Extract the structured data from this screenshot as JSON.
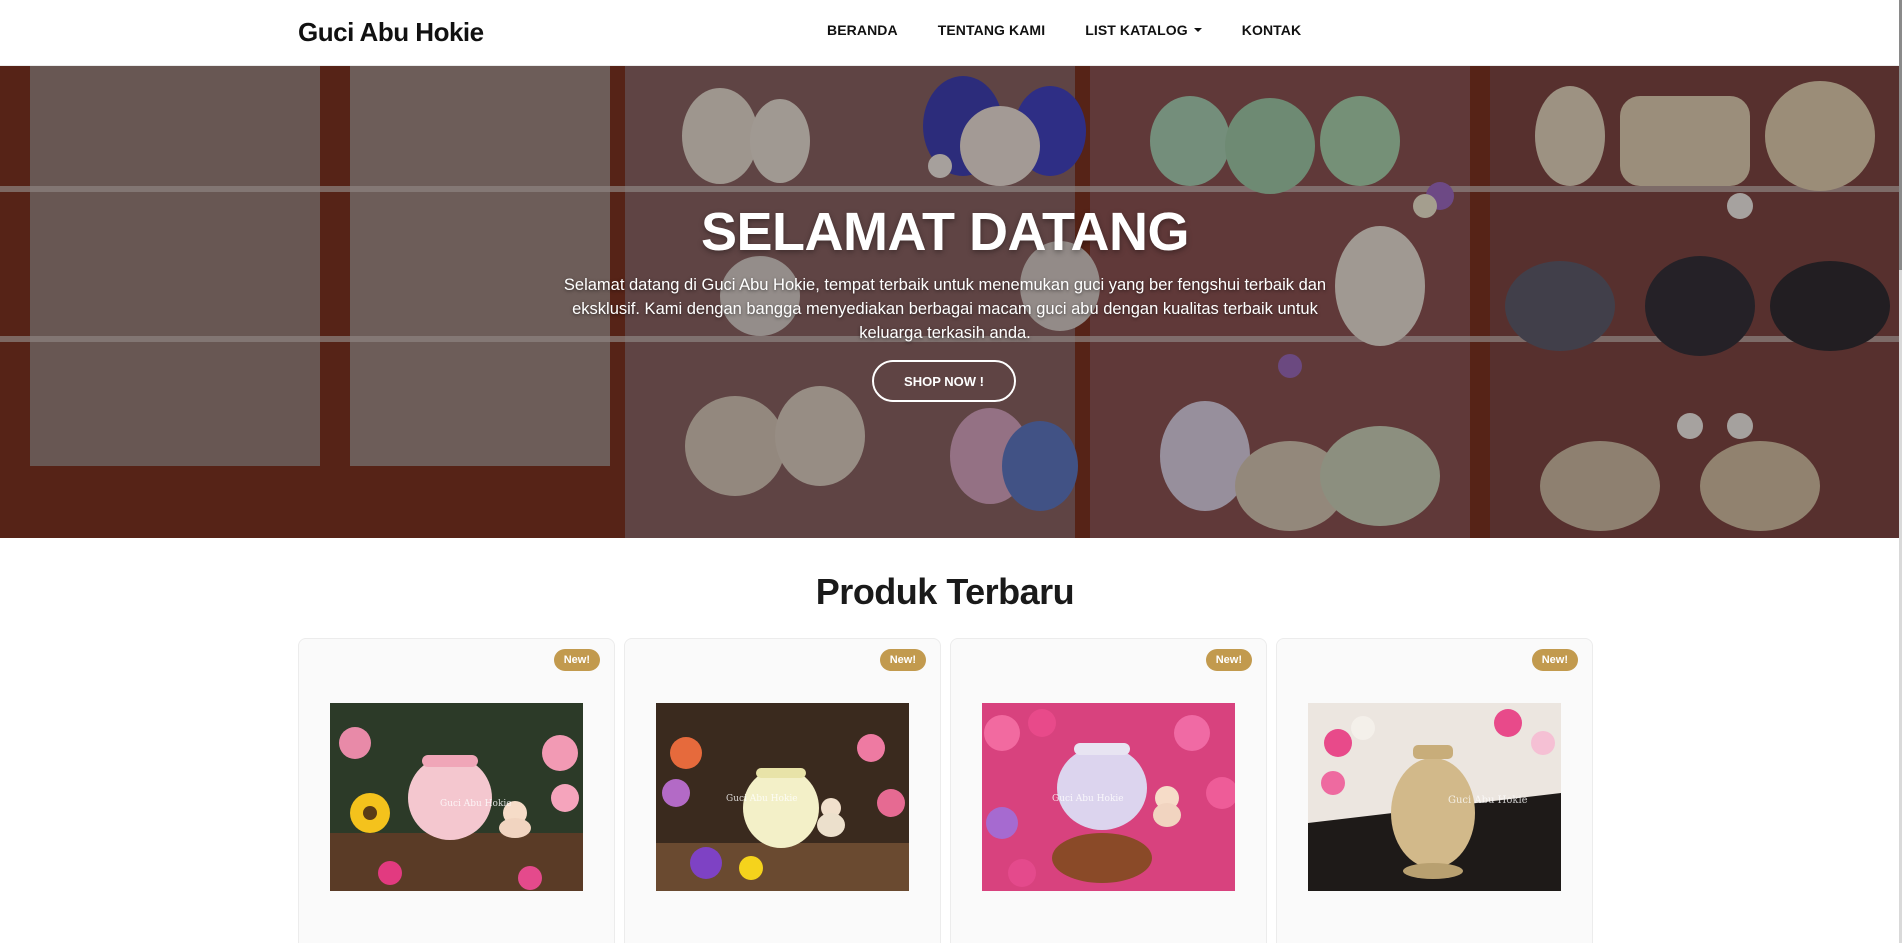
{
  "navbar": {
    "brand": "Guci Abu Hokie",
    "links": [
      {
        "label": "BERANDA"
      },
      {
        "label": "TENTANG KAMI"
      },
      {
        "label": "LIST KATALOG",
        "dropdown": true
      },
      {
        "label": "KONTAK"
      }
    ]
  },
  "hero": {
    "title": "SELAMAT DATANG",
    "text": "Selamat datang di Guci Abu Hokie, tempat terbaik untuk menemukan guci yang ber fengshui terbaik dan eksklusif. Kami dengan bangga menyediakan berbagai macam guci abu dengan kualitas terbaik untuk keluarga terkasih anda.",
    "button": "SHOP NOW !"
  },
  "products": {
    "title": "Produk Terbaru",
    "items": [
      {
        "badge": "New!",
        "watermark": "Guci Abu Hokie",
        "urn_color": "#f4c7cf"
      },
      {
        "badge": "New!",
        "watermark": "Guci Abu Hokie",
        "urn_color": "#f3f0c8"
      },
      {
        "badge": "New!",
        "watermark": "Guci Abu Hokie",
        "urn_color": "#dcd4ee"
      },
      {
        "badge": "New!",
        "watermark": "Guci Abu Hokie",
        "urn_color": "#d2b98a"
      }
    ]
  },
  "colors": {
    "badge": "#c29a4e",
    "navbar_bg": "#ffffff",
    "hero_overlay": "rgba(20,10,10,0.35)"
  }
}
